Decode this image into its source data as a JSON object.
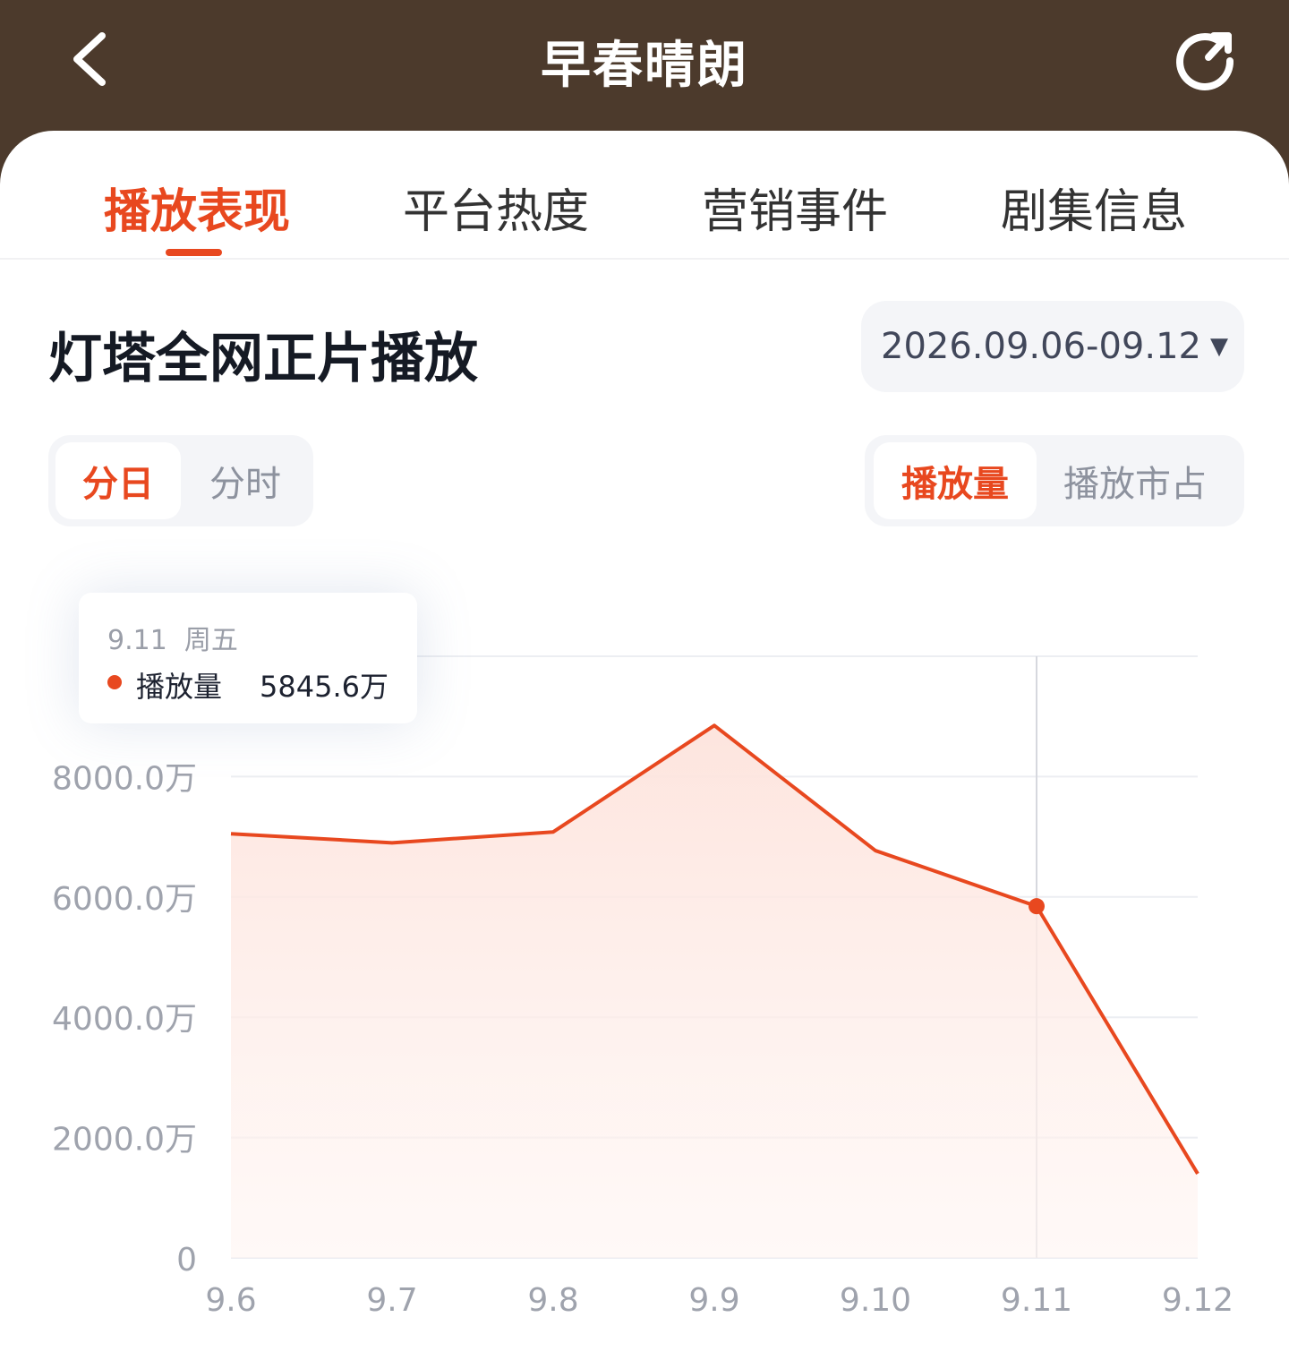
{
  "header": {
    "title": "早春晴朗"
  },
  "tabs": [
    {
      "label": "播放表现",
      "active": true
    },
    {
      "label": "平台热度",
      "active": false
    },
    {
      "label": "营销事件",
      "active": false
    },
    {
      "label": "剧集信息",
      "active": false
    }
  ],
  "section": {
    "title": "灯塔全网正片播放",
    "date_range": "2026.09.06-09.12"
  },
  "granularity": {
    "options": [
      "分日",
      "分时"
    ],
    "selected": "分日"
  },
  "metric": {
    "options": [
      "播放量",
      "播放市占"
    ],
    "selected": "播放量"
  },
  "tooltip": {
    "date": "9.11",
    "weekday": "周五",
    "series": "播放量",
    "value": "5845.6万"
  },
  "colors": {
    "accent": "#e8481f",
    "header_bg": "#4c3a2c"
  },
  "chart_data": {
    "type": "area",
    "categories": [
      "9.6",
      "9.7",
      "9.8",
      "9.9",
      "9.10",
      "9.11",
      "9.12"
    ],
    "series": [
      {
        "name": "播放量",
        "values": [
          7050,
          6900,
          7080,
          8850,
          6770,
          5845.6,
          1400
        ]
      }
    ],
    "y_ticks": [
      "0",
      "2000.0万",
      "4000.0万",
      "6000.0万",
      "8000.0万"
    ],
    "ylim": [
      0,
      10000
    ],
    "highlight_index": 5,
    "grid": true
  }
}
